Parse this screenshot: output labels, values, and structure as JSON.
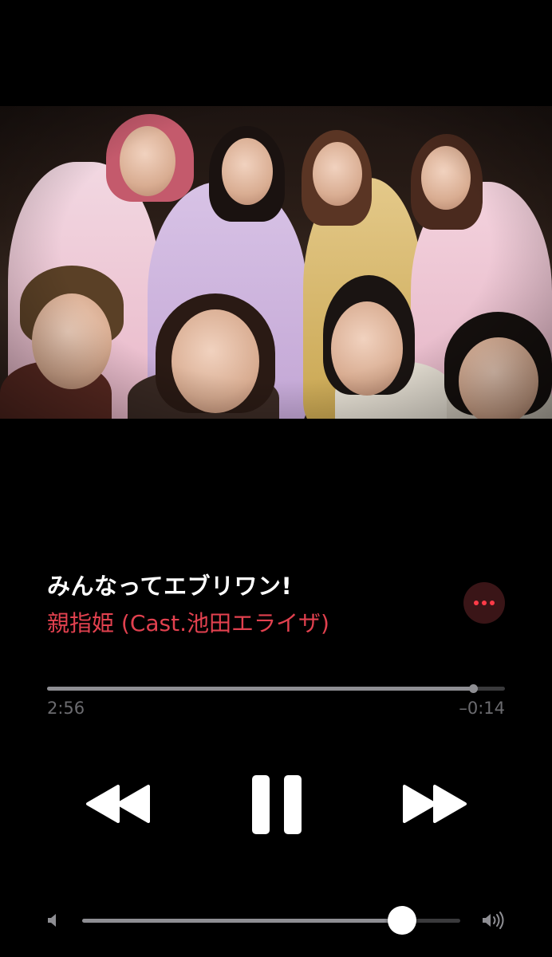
{
  "now_playing": {
    "title": "みんなってエブリワン!",
    "artist": "親指姫 (Cast.池田エライザ)",
    "artwork_icon": "album-artwork",
    "accent_color": "#e2414f"
  },
  "playback": {
    "elapsed": "2:56",
    "remaining": "–0:14",
    "progress_fraction": 0.93,
    "state": "playing"
  },
  "controls": {
    "rewind_icon": "rewind-icon",
    "pause_icon": "pause-icon",
    "forward_icon": "fast-forward-icon",
    "more_icon": "more-options-icon"
  },
  "volume": {
    "level_fraction": 0.845,
    "low_icon": "volume-low-icon",
    "high_icon": "volume-high-icon"
  }
}
